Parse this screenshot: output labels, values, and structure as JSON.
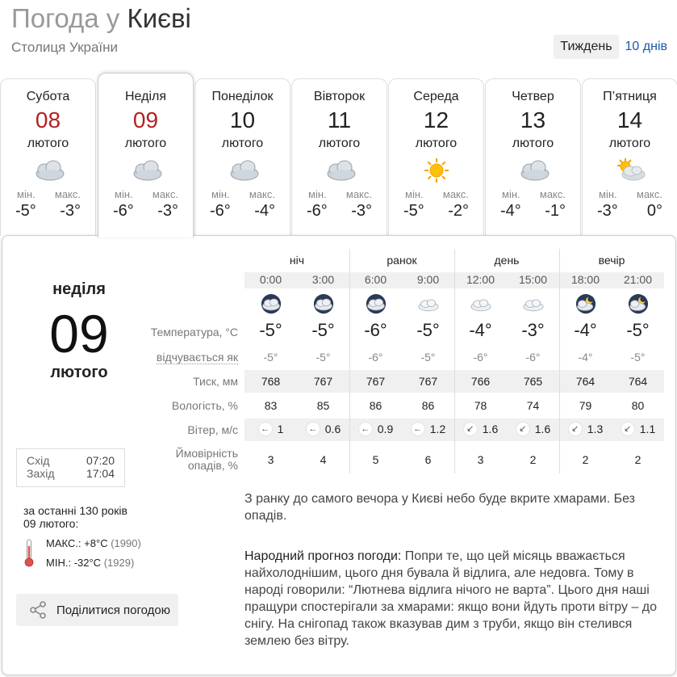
{
  "header": {
    "title_prefix": "Погода",
    "title_prep": "у",
    "title_city": "Києві",
    "subtitle": "Столиця України"
  },
  "view_switch": {
    "week": "Тиждень",
    "ten_days": "10 днів"
  },
  "days": [
    {
      "name": "Субота",
      "num": "08",
      "month": "лютого",
      "min_label": "мін.",
      "max_label": "макс.",
      "min": "-5°",
      "max": "-3°",
      "icon": "cloudy-icon",
      "weekend": true
    },
    {
      "name": "Неділя",
      "num": "09",
      "month": "лютого",
      "min_label": "мін.",
      "max_label": "макс.",
      "min": "-6°",
      "max": "-3°",
      "icon": "cloudy-icon",
      "weekend": true
    },
    {
      "name": "Понеділок",
      "num": "10",
      "month": "лютого",
      "min_label": "мін.",
      "max_label": "макс.",
      "min": "-6°",
      "max": "-4°",
      "icon": "cloudy-icon",
      "weekend": false
    },
    {
      "name": "Вівторок",
      "num": "11",
      "month": "лютого",
      "min_label": "мін.",
      "max_label": "макс.",
      "min": "-6°",
      "max": "-3°",
      "icon": "cloudy-icon",
      "weekend": false
    },
    {
      "name": "Середа",
      "num": "12",
      "month": "лютого",
      "min_label": "мін.",
      "max_label": "макс.",
      "min": "-5°",
      "max": "-2°",
      "icon": "sun-icon",
      "weekend": false
    },
    {
      "name": "Четвер",
      "num": "13",
      "month": "лютого",
      "min_label": "мін.",
      "max_label": "макс.",
      "min": "-4°",
      "max": "-1°",
      "icon": "cloudy-icon",
      "weekend": false
    },
    {
      "name": "П’ятниця",
      "num": "14",
      "month": "лютого",
      "min_label": "мін.",
      "max_label": "макс.",
      "min": "-3°",
      "max": "0°",
      "icon": "partly-cloudy-icon",
      "weekend": false
    }
  ],
  "selected": {
    "day_name": "неділя",
    "day_num": "09",
    "month": "лютого",
    "sunrise_label": "Схід",
    "sunrise": "07:20",
    "sunset_label": "Захід",
    "sunset": "17:04",
    "history_line1": "за останні 130 років",
    "history_line2": "09 лютого:",
    "max_label": "МАКС.:",
    "max_val": "+8°C",
    "max_year": "(1990)",
    "min_label": "МІН.:",
    "min_val": "-32°C",
    "min_year": "(1929)",
    "share": "Поділитися погодою"
  },
  "table": {
    "periods": [
      "ніч",
      "ранок",
      "день",
      "вечір"
    ],
    "hours": [
      "0:00",
      "3:00",
      "6:00",
      "9:00",
      "12:00",
      "15:00",
      "18:00",
      "21:00"
    ],
    "labels": {
      "temp": "Температура, °C",
      "feels": "відчувається як",
      "pressure": "Тиск, мм",
      "humidity": "Вологість, %",
      "wind": "Вітер, м/с",
      "precip_1": "Ймовірність",
      "precip_2": "опадів, %"
    },
    "icons": [
      "night-cloudy-icon",
      "night-cloudy-icon",
      "night-cloudy-icon",
      "cloud-icon",
      "cloud-icon",
      "cloud-icon",
      "night-cloudy-moon-icon",
      "night-cloudy-moon-icon"
    ],
    "temp": [
      "-5°",
      "-5°",
      "-6°",
      "-5°",
      "-4°",
      "-3°",
      "-4°",
      "-5°"
    ],
    "feels": [
      "-5°",
      "-5°",
      "-6°",
      "-5°",
      "-6°",
      "-6°",
      "-4°",
      "-5°"
    ],
    "pressure": [
      "768",
      "767",
      "767",
      "767",
      "766",
      "765",
      "764",
      "764"
    ],
    "humidity": [
      "83",
      "85",
      "86",
      "86",
      "78",
      "74",
      "79",
      "80"
    ],
    "wind_dir": [
      "←",
      "←",
      "←",
      "←",
      "↙",
      "↙",
      "↙",
      "↙"
    ],
    "wind": [
      "1",
      "0.6",
      "0.9",
      "1.2",
      "1.6",
      "1.6",
      "1.3",
      "1.1"
    ],
    "precip": [
      "3",
      "4",
      "5",
      "6",
      "3",
      "2",
      "2",
      "2"
    ]
  },
  "description": "З ранку до самого вечора у Києві небо буде вкрите хмарами. Без опадів.",
  "folk": {
    "label": "Народний прогноз погоди:",
    "text": " Попри те, що цей місяць вважається найхолоднішим, цього дня бувала й відлига, але недовга. Тому в народі говорили: “Лютнева відлига нічого не варта”. Цього дня наші пращури спостерігали за хмарами: якщо вони йдуть проти вітру – до снігу. На снігопад також вказував дим з труби, якщо він стелився землею без вітру."
  },
  "colors": {
    "weekend_red": "#b22222",
    "link_blue": "#1a5aa7"
  }
}
